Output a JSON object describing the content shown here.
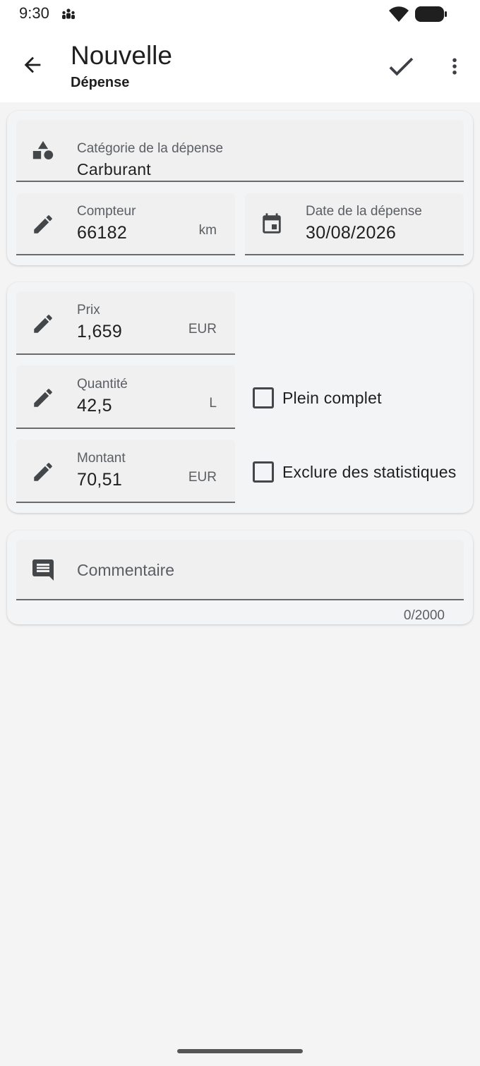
{
  "status_bar": {
    "time": "9:30",
    "notification_icon": "people-group-icon",
    "wifi_icon": "wifi-icon",
    "battery_icon": "battery-icon"
  },
  "app_bar": {
    "back_icon": "arrow-back-icon",
    "title": "Nouvelle",
    "subtitle": "Dépense",
    "confirm_icon": "check-icon",
    "more_icon": "more-vert-icon"
  },
  "card1": {
    "category": {
      "label": "Catégorie de la dépense",
      "value": "Carburant",
      "icon": "shapes-icon"
    },
    "odometer": {
      "label": "Compteur",
      "value": "66182",
      "suffix": "km",
      "icon": "pencil-icon"
    },
    "date": {
      "label": "Date de la dépense",
      "value": "30/08/2026",
      "icon": "calendar-icon"
    }
  },
  "card2": {
    "price": {
      "label": "Prix",
      "value": "1,659",
      "suffix": "EUR",
      "icon": "pencil-icon"
    },
    "quantity": {
      "label": "Quantité",
      "value": "42,5",
      "suffix": "L",
      "icon": "pencil-icon"
    },
    "amount": {
      "label": "Montant",
      "value": "70,51",
      "suffix": "EUR",
      "icon": "pencil-icon"
    },
    "full_tank": {
      "label": "Plein complet",
      "checked": false
    },
    "exclude_stats": {
      "label": "Exclure des statistiques",
      "checked": false
    }
  },
  "card3": {
    "comment": {
      "placeholder": "Commentaire",
      "counter": "0/2000",
      "icon": "comment-icon"
    }
  },
  "colors": {
    "background": "#f4f4f4",
    "card": "#f3f4f6",
    "field": "#f0f0f0",
    "icon": "#44474a",
    "underline": "#6b6b6b"
  }
}
